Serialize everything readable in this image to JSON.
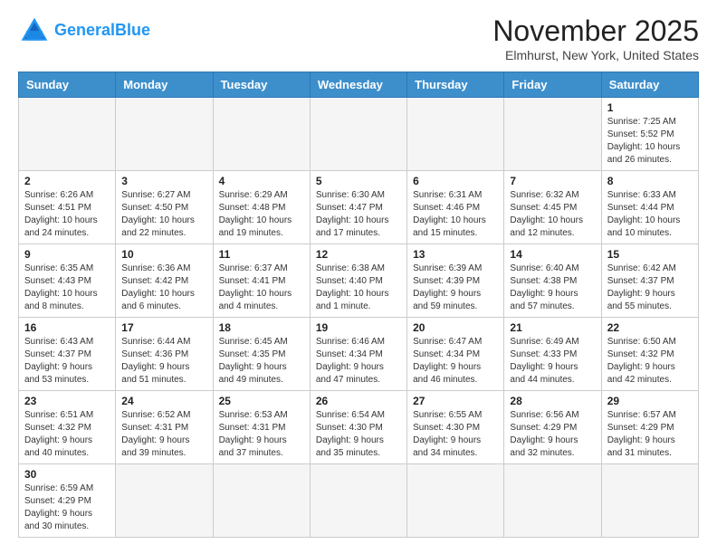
{
  "header": {
    "logo_line1": "General",
    "logo_line2": "Blue",
    "title": "November 2025",
    "subtitle": "Elmhurst, New York, United States"
  },
  "weekdays": [
    "Sunday",
    "Monday",
    "Tuesday",
    "Wednesday",
    "Thursday",
    "Friday",
    "Saturday"
  ],
  "weeks": [
    [
      {
        "day": "",
        "info": ""
      },
      {
        "day": "",
        "info": ""
      },
      {
        "day": "",
        "info": ""
      },
      {
        "day": "",
        "info": ""
      },
      {
        "day": "",
        "info": ""
      },
      {
        "day": "",
        "info": ""
      },
      {
        "day": "1",
        "info": "Sunrise: 7:25 AM\nSunset: 5:52 PM\nDaylight: 10 hours\nand 26 minutes."
      }
    ],
    [
      {
        "day": "2",
        "info": "Sunrise: 6:26 AM\nSunset: 4:51 PM\nDaylight: 10 hours\nand 24 minutes."
      },
      {
        "day": "3",
        "info": "Sunrise: 6:27 AM\nSunset: 4:50 PM\nDaylight: 10 hours\nand 22 minutes."
      },
      {
        "day": "4",
        "info": "Sunrise: 6:29 AM\nSunset: 4:48 PM\nDaylight: 10 hours\nand 19 minutes."
      },
      {
        "day": "5",
        "info": "Sunrise: 6:30 AM\nSunset: 4:47 PM\nDaylight: 10 hours\nand 17 minutes."
      },
      {
        "day": "6",
        "info": "Sunrise: 6:31 AM\nSunset: 4:46 PM\nDaylight: 10 hours\nand 15 minutes."
      },
      {
        "day": "7",
        "info": "Sunrise: 6:32 AM\nSunset: 4:45 PM\nDaylight: 10 hours\nand 12 minutes."
      },
      {
        "day": "8",
        "info": "Sunrise: 6:33 AM\nSunset: 4:44 PM\nDaylight: 10 hours\nand 10 minutes."
      }
    ],
    [
      {
        "day": "9",
        "info": "Sunrise: 6:35 AM\nSunset: 4:43 PM\nDaylight: 10 hours\nand 8 minutes."
      },
      {
        "day": "10",
        "info": "Sunrise: 6:36 AM\nSunset: 4:42 PM\nDaylight: 10 hours\nand 6 minutes."
      },
      {
        "day": "11",
        "info": "Sunrise: 6:37 AM\nSunset: 4:41 PM\nDaylight: 10 hours\nand 4 minutes."
      },
      {
        "day": "12",
        "info": "Sunrise: 6:38 AM\nSunset: 4:40 PM\nDaylight: 10 hours\nand 1 minute."
      },
      {
        "day": "13",
        "info": "Sunrise: 6:39 AM\nSunset: 4:39 PM\nDaylight: 9 hours\nand 59 minutes."
      },
      {
        "day": "14",
        "info": "Sunrise: 6:40 AM\nSunset: 4:38 PM\nDaylight: 9 hours\nand 57 minutes."
      },
      {
        "day": "15",
        "info": "Sunrise: 6:42 AM\nSunset: 4:37 PM\nDaylight: 9 hours\nand 55 minutes."
      }
    ],
    [
      {
        "day": "16",
        "info": "Sunrise: 6:43 AM\nSunset: 4:37 PM\nDaylight: 9 hours\nand 53 minutes."
      },
      {
        "day": "17",
        "info": "Sunrise: 6:44 AM\nSunset: 4:36 PM\nDaylight: 9 hours\nand 51 minutes."
      },
      {
        "day": "18",
        "info": "Sunrise: 6:45 AM\nSunset: 4:35 PM\nDaylight: 9 hours\nand 49 minutes."
      },
      {
        "day": "19",
        "info": "Sunrise: 6:46 AM\nSunset: 4:34 PM\nDaylight: 9 hours\nand 47 minutes."
      },
      {
        "day": "20",
        "info": "Sunrise: 6:47 AM\nSunset: 4:34 PM\nDaylight: 9 hours\nand 46 minutes."
      },
      {
        "day": "21",
        "info": "Sunrise: 6:49 AM\nSunset: 4:33 PM\nDaylight: 9 hours\nand 44 minutes."
      },
      {
        "day": "22",
        "info": "Sunrise: 6:50 AM\nSunset: 4:32 PM\nDaylight: 9 hours\nand 42 minutes."
      }
    ],
    [
      {
        "day": "23",
        "info": "Sunrise: 6:51 AM\nSunset: 4:32 PM\nDaylight: 9 hours\nand 40 minutes."
      },
      {
        "day": "24",
        "info": "Sunrise: 6:52 AM\nSunset: 4:31 PM\nDaylight: 9 hours\nand 39 minutes."
      },
      {
        "day": "25",
        "info": "Sunrise: 6:53 AM\nSunset: 4:31 PM\nDaylight: 9 hours\nand 37 minutes."
      },
      {
        "day": "26",
        "info": "Sunrise: 6:54 AM\nSunset: 4:30 PM\nDaylight: 9 hours\nand 35 minutes."
      },
      {
        "day": "27",
        "info": "Sunrise: 6:55 AM\nSunset: 4:30 PM\nDaylight: 9 hours\nand 34 minutes."
      },
      {
        "day": "28",
        "info": "Sunrise: 6:56 AM\nSunset: 4:29 PM\nDaylight: 9 hours\nand 32 minutes."
      },
      {
        "day": "29",
        "info": "Sunrise: 6:57 AM\nSunset: 4:29 PM\nDaylight: 9 hours\nand 31 minutes."
      }
    ],
    [
      {
        "day": "30",
        "info": "Sunrise: 6:59 AM\nSunset: 4:29 PM\nDaylight: 9 hours\nand 30 minutes."
      },
      {
        "day": "",
        "info": ""
      },
      {
        "day": "",
        "info": ""
      },
      {
        "day": "",
        "info": ""
      },
      {
        "day": "",
        "info": ""
      },
      {
        "day": "",
        "info": ""
      },
      {
        "day": "",
        "info": ""
      }
    ]
  ]
}
